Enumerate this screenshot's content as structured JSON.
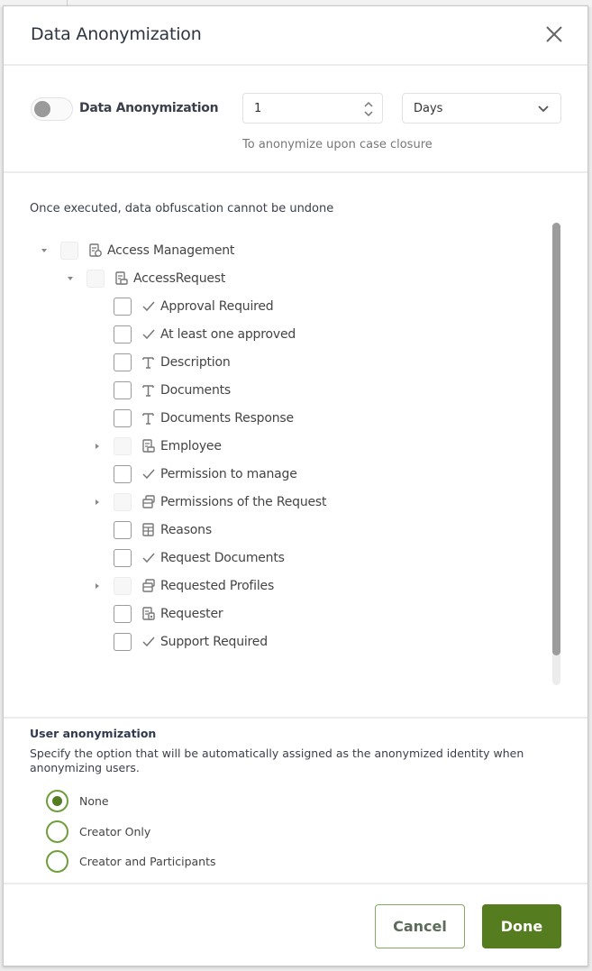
{
  "dialog": {
    "title": "Data Anonymization",
    "close_icon": "close-icon"
  },
  "settings": {
    "toggle_label": "Data Anonymization",
    "toggle_on": false,
    "period_value": "1",
    "period_unit": "Days",
    "hint": "To anonymize upon case closure"
  },
  "tree": {
    "warning": "Once executed, data obfuscation cannot be undone",
    "nodes": [
      {
        "label": "Access Management",
        "icon": "entity-settings-icon",
        "level": 0,
        "expander": "expanded",
        "checkbox": "disabled"
      },
      {
        "label": "AccessRequest",
        "icon": "entity-form-icon",
        "level": 1,
        "expander": "expanded",
        "checkbox": "disabled"
      },
      {
        "label": "Approval Required",
        "icon": "boolean-check-icon",
        "level": 2,
        "expander": "none",
        "checkbox": "enabled"
      },
      {
        "label": "At least one approved",
        "icon": "boolean-check-icon",
        "level": 2,
        "expander": "none",
        "checkbox": "enabled"
      },
      {
        "label": "Description",
        "icon": "text-icon",
        "level": 2,
        "expander": "none",
        "checkbox": "enabled"
      },
      {
        "label": "Documents",
        "icon": "text-icon",
        "level": 2,
        "expander": "none",
        "checkbox": "enabled"
      },
      {
        "label": "Documents Response",
        "icon": "text-icon",
        "level": 2,
        "expander": "none",
        "checkbox": "enabled"
      },
      {
        "label": "Employee",
        "icon": "entity-form-icon",
        "level": 2,
        "expander": "collapsed",
        "checkbox": "disabled"
      },
      {
        "label": "Permission to manage",
        "icon": "boolean-check-icon",
        "level": 2,
        "expander": "none",
        "checkbox": "enabled"
      },
      {
        "label": "Permissions of the Request",
        "icon": "collection-icon",
        "level": 2,
        "expander": "collapsed",
        "checkbox": "disabled"
      },
      {
        "label": "Reasons",
        "icon": "entity-list-icon",
        "level": 2,
        "expander": "none",
        "checkbox": "enabled"
      },
      {
        "label": "Request Documents",
        "icon": "boolean-check-icon",
        "level": 2,
        "expander": "none",
        "checkbox": "enabled"
      },
      {
        "label": "Requested Profiles",
        "icon": "collection-icon",
        "level": 2,
        "expander": "collapsed",
        "checkbox": "disabled"
      },
      {
        "label": "Requester",
        "icon": "user-entity-icon",
        "level": 2,
        "expander": "none",
        "checkbox": "enabled"
      },
      {
        "label": "Support Required",
        "icon": "boolean-check-icon",
        "level": 2,
        "expander": "none",
        "checkbox": "enabled"
      }
    ]
  },
  "user_anonymization": {
    "title": "User anonymization",
    "description": "Specify the option that will be automatically assigned as the anonymized identity when anonymizing users.",
    "options": [
      {
        "label": "None",
        "selected": true
      },
      {
        "label": "Creator Only",
        "selected": false
      },
      {
        "label": "Creator and Participants",
        "selected": false
      }
    ]
  },
  "footer": {
    "cancel_label": "Cancel",
    "done_label": "Done"
  },
  "colors": {
    "accent": "#557d1f",
    "radio_border": "#6f9e3c",
    "cancel_border": "#84a866"
  }
}
